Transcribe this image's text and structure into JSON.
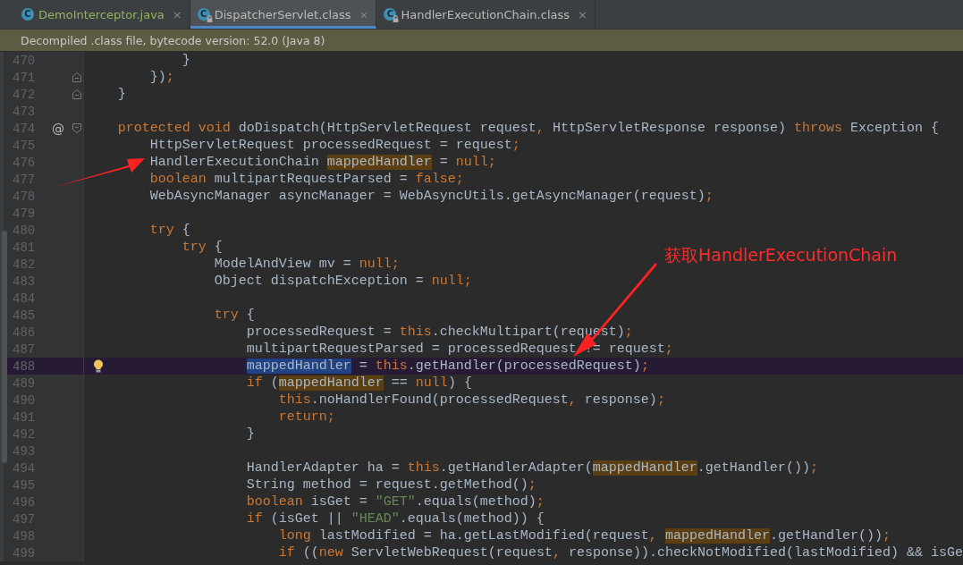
{
  "tabs": [
    {
      "icon_letter": "C",
      "label": "DemoInterceptor.java",
      "locked": false,
      "color": "#8fb55e",
      "selected": false,
      "close": "×"
    },
    {
      "icon_letter": "C",
      "label": "DispatcherServlet.class",
      "locked": true,
      "color": "#bbbbbb",
      "selected": true,
      "close": "×"
    },
    {
      "icon_letter": "C",
      "label": "HandlerExecutionChain.class",
      "locked": true,
      "color": "#bbbbbb",
      "selected": false,
      "close": "×"
    }
  ],
  "banner": {
    "text": "Decompiled .class file, bytecode version: 52.0 (Java 8)"
  },
  "editor": {
    "lines": [
      {
        "number": "470",
        "tokens": [
          {
            "kind": "plain",
            "text": "            }"
          }
        ]
      },
      {
        "number": "471",
        "gutter_icon": {
          "kind": "fold-end"
        },
        "tokens": [
          {
            "kind": "plain",
            "text": "        })"
          },
          {
            "kind": "punct",
            "text": ";"
          }
        ]
      },
      {
        "number": "472",
        "gutter_icon": {
          "kind": "fold-end"
        },
        "tokens": [
          {
            "kind": "plain",
            "text": "    }"
          }
        ]
      },
      {
        "number": "473"
      },
      {
        "number": "474",
        "gutter_text": "@",
        "gutter_icon": {
          "kind": "fold"
        },
        "tokens": [
          {
            "kind": "kw",
            "text": "    protected void"
          },
          {
            "kind": "plain",
            "text": " doDispatch(HttpServletRequest request"
          },
          {
            "kind": "punct",
            "text": ","
          },
          {
            "kind": "plain",
            "text": " HttpServletResponse response) "
          },
          {
            "kind": "kw",
            "text": "throws"
          },
          {
            "kind": "plain",
            "text": " Exception {"
          }
        ]
      },
      {
        "number": "475",
        "tokens": [
          {
            "kind": "plain",
            "text": "        HttpServletRequest processedRequest = request"
          },
          {
            "kind": "punct",
            "text": ";"
          }
        ]
      },
      {
        "number": "476",
        "tokens": [
          {
            "kind": "plain",
            "text": "        HandlerExecutionChain "
          },
          {
            "kind": "usage",
            "text": "mappedHandler"
          },
          {
            "kind": "plain",
            "text": " = "
          },
          {
            "kind": "kw",
            "text": "null"
          },
          {
            "kind": "punct",
            "text": ";"
          }
        ]
      },
      {
        "number": "477",
        "tokens": [
          {
            "kind": "kw",
            "text": "        boolean"
          },
          {
            "kind": "plain",
            "text": " multipartRequestParsed = "
          },
          {
            "kind": "kw",
            "text": "false"
          },
          {
            "kind": "punct",
            "text": ";"
          }
        ]
      },
      {
        "number": "478",
        "tokens": [
          {
            "kind": "plain",
            "text": "        WebAsyncManager asyncManager = WebAsyncUtils.getAsyncManager(request)"
          },
          {
            "kind": "punct",
            "text": ";"
          }
        ]
      },
      {
        "number": "479"
      },
      {
        "number": "480",
        "tokens": [
          {
            "kind": "kw",
            "text": "        try"
          },
          {
            "kind": "plain",
            "text": " {"
          }
        ]
      },
      {
        "number": "481",
        "tokens": [
          {
            "kind": "kw",
            "text": "            try"
          },
          {
            "kind": "plain",
            "text": " {"
          }
        ]
      },
      {
        "number": "482",
        "tokens": [
          {
            "kind": "plain",
            "text": "                ModelAndView mv = "
          },
          {
            "kind": "kw",
            "text": "null"
          },
          {
            "kind": "punct",
            "text": ";"
          }
        ]
      },
      {
        "number": "483",
        "tokens": [
          {
            "kind": "plain",
            "text": "                Object dispatchException = "
          },
          {
            "kind": "kw",
            "text": "null"
          },
          {
            "kind": "punct",
            "text": ";"
          }
        ]
      },
      {
        "number": "484"
      },
      {
        "number": "485",
        "tokens": [
          {
            "kind": "kw",
            "text": "                try"
          },
          {
            "kind": "plain",
            "text": " {"
          }
        ]
      },
      {
        "number": "486",
        "tokens": [
          {
            "kind": "plain",
            "text": "                    processedRequest = "
          },
          {
            "kind": "kw",
            "text": "this"
          },
          {
            "kind": "plain",
            "text": ".checkMultipart(request)"
          },
          {
            "kind": "punct",
            "text": ";"
          }
        ]
      },
      {
        "number": "487",
        "tokens": [
          {
            "kind": "plain",
            "text": "                    multipartRequestParsed = processedRequest != request"
          },
          {
            "kind": "punct",
            "text": ";"
          }
        ]
      },
      {
        "number": "488",
        "current": true,
        "gutter_icon": {
          "kind": "bulb"
        },
        "tokens": [
          {
            "kind": "selected",
            "text": "                    mappedHandler"
          },
          {
            "kind": "plain",
            "text": " = "
          },
          {
            "kind": "kw",
            "text": "this"
          },
          {
            "kind": "plain",
            "text": ".getHandler(processedRequest)"
          },
          {
            "kind": "punct",
            "text": ";"
          }
        ]
      },
      {
        "number": "489",
        "tokens": [
          {
            "kind": "kw",
            "text": "                    if"
          },
          {
            "kind": "plain",
            "text": " ("
          },
          {
            "kind": "usage",
            "text": "mappedHandler"
          },
          {
            "kind": "plain",
            "text": " == "
          },
          {
            "kind": "kw",
            "text": "null"
          },
          {
            "kind": "plain",
            "text": ") {"
          }
        ]
      },
      {
        "number": "490",
        "tokens": [
          {
            "kind": "kw",
            "text": "                        this"
          },
          {
            "kind": "plain",
            "text": ".noHandlerFound(processedRequest"
          },
          {
            "kind": "punct",
            "text": ","
          },
          {
            "kind": "plain",
            "text": " response)"
          },
          {
            "kind": "punct",
            "text": ";"
          }
        ]
      },
      {
        "number": "491",
        "tokens": [
          {
            "kind": "kw",
            "text": "                        return"
          },
          {
            "kind": "punct",
            "text": ";"
          }
        ]
      },
      {
        "number": "492",
        "tokens": [
          {
            "kind": "plain",
            "text": "                    }"
          }
        ]
      },
      {
        "number": "493"
      },
      {
        "number": "494",
        "tokens": [
          {
            "kind": "plain",
            "text": "                    HandlerAdapter ha = "
          },
          {
            "kind": "kw",
            "text": "this"
          },
          {
            "kind": "plain",
            "text": ".getHandlerAdapter("
          },
          {
            "kind": "usage",
            "text": "mappedHandler"
          },
          {
            "kind": "plain",
            "text": ".getHandler())"
          },
          {
            "kind": "punct",
            "text": ";"
          }
        ]
      },
      {
        "number": "495",
        "tokens": [
          {
            "kind": "plain",
            "text": "                    String method = request.getMethod()"
          },
          {
            "kind": "punct",
            "text": ";"
          }
        ]
      },
      {
        "number": "496",
        "tokens": [
          {
            "kind": "kw",
            "text": "                    boolean"
          },
          {
            "kind": "plain",
            "text": " isGet = "
          },
          {
            "kind": "str",
            "text": "\"GET\""
          },
          {
            "kind": "plain",
            "text": ".equals(method)"
          },
          {
            "kind": "punct",
            "text": ";"
          }
        ]
      },
      {
        "number": "497",
        "tokens": [
          {
            "kind": "kw",
            "text": "                    if"
          },
          {
            "kind": "plain",
            "text": " (isGet || "
          },
          {
            "kind": "str",
            "text": "\"HEAD\""
          },
          {
            "kind": "plain",
            "text": ".equals(method)) {"
          }
        ]
      },
      {
        "number": "498",
        "tokens": [
          {
            "kind": "kw",
            "text": "                        long"
          },
          {
            "kind": "plain",
            "text": " lastModified = ha.getLastModified(request"
          },
          {
            "kind": "punct",
            "text": ", "
          },
          {
            "kind": "usage",
            "text": "mappedHandler"
          },
          {
            "kind": "plain",
            "text": ".getHandler())"
          },
          {
            "kind": "punct",
            "text": ";"
          }
        ]
      },
      {
        "number": "499",
        "tokens": [
          {
            "kind": "kw",
            "text": "                        if"
          },
          {
            "kind": "plain",
            "text": " (("
          },
          {
            "kind": "kw",
            "text": "new"
          },
          {
            "kind": "plain",
            "text": " ServletWebRequest(request"
          },
          {
            "kind": "punct",
            "text": ","
          },
          {
            "kind": "plain",
            "text": " response)).checkNotModified(lastModified) && isGe"
          }
        ]
      }
    ]
  },
  "annotation": {
    "text": "获取HandlerExecutionChain"
  }
}
